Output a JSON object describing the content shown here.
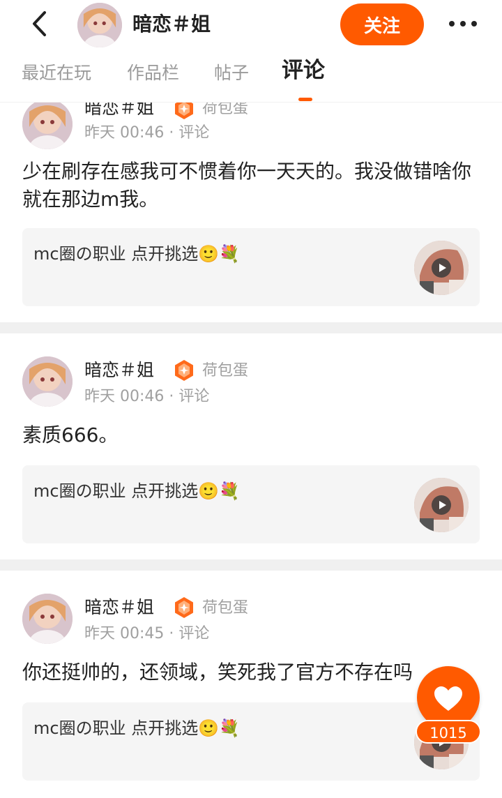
{
  "header": {
    "user_name": "暗恋＃姐",
    "follow_label": "关注"
  },
  "tabs": [
    {
      "label": "最近在玩",
      "active": false
    },
    {
      "label": "作品栏",
      "active": false
    },
    {
      "label": "帖子",
      "active": false
    },
    {
      "label": "评论",
      "active": true
    }
  ],
  "comments": [
    {
      "user_name": "暗恋＃姐",
      "level": "荷包蛋",
      "time": "昨天 00:46",
      "type": "评论",
      "text": "少在刷存在感我可不惯着你一天天的。我没做错啥你就在那边m我。",
      "card_title": "mc圈の职业 点开挑选🙂💐"
    },
    {
      "user_name": "暗恋＃姐",
      "level": "荷包蛋",
      "time": "昨天 00:46",
      "type": "评论",
      "text": "素质666。",
      "card_title": "mc圈の职业 点开挑选🙂💐"
    },
    {
      "user_name": "暗恋＃姐",
      "level": "荷包蛋",
      "time": "昨天 00:45",
      "type": "评论",
      "text": "你还挺帅的，还领域，笑死我了官方不存在吗",
      "card_title": "mc圈の职业 点开挑选🙂💐"
    }
  ],
  "like": {
    "count": "1015"
  },
  "colors": {
    "accent": "#ff5a00",
    "badge": "#ff6a1a",
    "divider": "#f0f0f0"
  }
}
